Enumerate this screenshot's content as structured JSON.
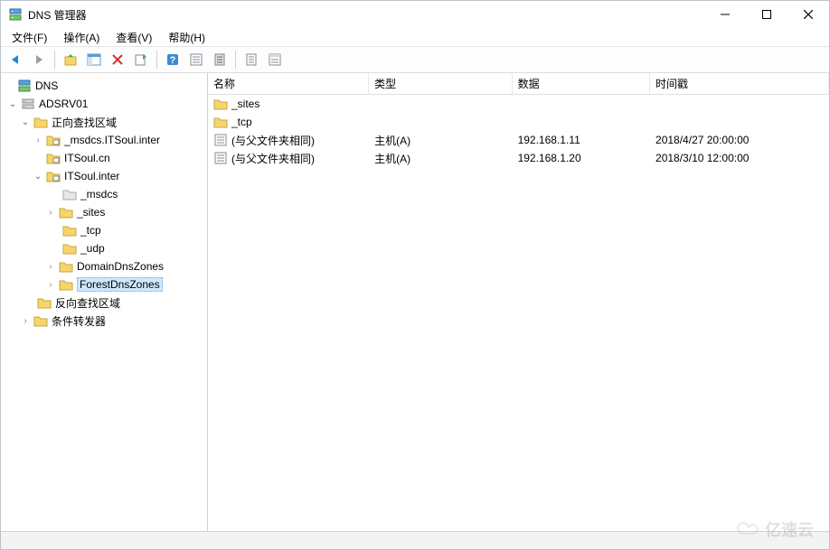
{
  "window": {
    "title": "DNS 管理器"
  },
  "menu": {
    "file": "文件(F)",
    "action": "操作(A)",
    "view": "查看(V)",
    "help": "帮助(H)"
  },
  "tree": {
    "root": "DNS",
    "server": "ADSRV01",
    "forward_zone": "正向查找区域",
    "zone1": "_msdcs.ITSoul.inter",
    "zone2": "ITSoul.cn",
    "zone3": "ITSoul.inter",
    "sub_msdcs": "_msdcs",
    "sub_sites": "_sites",
    "sub_tcp": "_tcp",
    "sub_udp": "_udp",
    "sub_domain": "DomainDnsZones",
    "sub_forest": "ForestDnsZones",
    "reverse_zone": "反向查找区域",
    "conditional": "条件转发器"
  },
  "columns": {
    "name": "名称",
    "type": "类型",
    "data": "数据",
    "timestamp": "时间戳"
  },
  "records": [
    {
      "name": "_sites",
      "type": "",
      "data": "",
      "timestamp": "",
      "icon": "folder"
    },
    {
      "name": "_tcp",
      "type": "",
      "data": "",
      "timestamp": "",
      "icon": "folder"
    },
    {
      "name": "(与父文件夹相同)",
      "type": "主机(A)",
      "data": "192.168.1.11",
      "timestamp": "2018/4/27 20:00:00",
      "icon": "record"
    },
    {
      "name": "(与父文件夹相同)",
      "type": "主机(A)",
      "data": "192.168.1.20",
      "timestamp": "2018/3/10 12:00:00",
      "icon": "record"
    }
  ],
  "watermark": "亿速云"
}
